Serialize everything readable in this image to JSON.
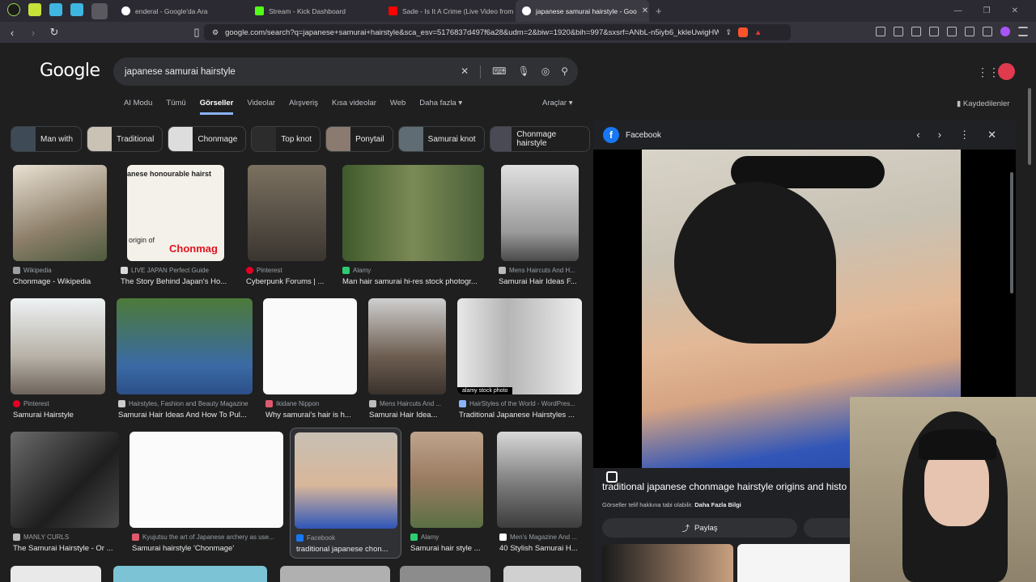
{
  "tabs": [
    {
      "title": "enderal - Google'da Ara",
      "color": "#4285f4",
      "active": false
    },
    {
      "title": "Stream - Kick Dashboard",
      "color": "#53fc18",
      "active": false
    },
    {
      "title": "Sade - Is It A Crime (Live Video from",
      "color": "#ff0000",
      "active": false
    },
    {
      "title": "japanese samurai hairstyle - Goo",
      "color": "#4285f4",
      "active": true
    }
  ],
  "browser": {
    "url": "google.com/search?q=japanese+samurai+hairstyle&sca_esv=5176837d497f6a28&udm=2&biw=1920&bih=997&sxsrf=ANbL-n5iyb6_kkleUwigHWH...",
    "new_tab": "+"
  },
  "google": {
    "logo": "Google",
    "query": "japanese samurai hairstyle",
    "filters": [
      "AI Modu",
      "Tümü",
      "Görseller",
      "Videolar",
      "Alışveriş",
      "Kısa videolar",
      "Web",
      "Daha fazla ▾"
    ],
    "tools": "Araçlar ▾",
    "saved": "Kaydedilenler"
  },
  "chips": [
    "Man with",
    "Traditional",
    "Chonmage",
    "Top knot",
    "Ponytail",
    "Samurai knot",
    "Chonmage hairstyle"
  ],
  "results": [
    {
      "source": "Wikipedia",
      "title": "Chonmage - Wikipedia",
      "color": "#9aa0a6"
    },
    {
      "source": "LIVE JAPAN Perfect Guide",
      "title": "The Story Behind Japan's Ho...",
      "color": "#d9d9d9"
    },
    {
      "source": "Pinterest",
      "title": "Cyberpunk Forums | ...",
      "color": "#e60023"
    },
    {
      "source": "Alamy",
      "title": "Man hair samurai hi-res stock photogr...",
      "color": "#2ecc71"
    },
    {
      "source": "Mens Haircuts And H...",
      "title": "Samurai Hair Ideas F...",
      "color": "#bbbbbb"
    },
    {
      "source": "Pinterest",
      "title": "Samurai Hairstyle",
      "color": "#e60023"
    },
    {
      "source": "Hairstyles, Fashion and Beauty Magazine",
      "title": "Samurai Hair Ideas And How To Pul...",
      "color": "#cccccc"
    },
    {
      "source": "Ikidane Nippon",
      "title": "Why samurai's hair is h...",
      "color": "#e05a6d"
    },
    {
      "source": "Mens Haircuts And ...",
      "title": "Samurai Hair Idea...",
      "color": "#bbbbbb"
    },
    {
      "source": "HairStyles of the World - WordPres...",
      "title": "Traditional Japanese Hairstyles ...",
      "color": "#8ab4f8"
    },
    {
      "source": "MANLY CURLS",
      "title": "The Samurai Hairstyle - Or ...",
      "color": "#bbbbbb"
    },
    {
      "source": "Kyujutsu the art of Japanese archery as use...",
      "title": "Samurai hairstyle 'Chonmage'",
      "color": "#e05a6d"
    },
    {
      "source": "Facebook",
      "title": "traditional japanese chon...",
      "color": "#1877f2"
    },
    {
      "source": "Alamy",
      "title": "Samurai hair style ...",
      "color": "#2ecc71"
    },
    {
      "source": "Men's Magazine And ...",
      "title": "40 Stylish Samurai H...",
      "color": "#ffffff"
    }
  ],
  "overlays": {
    "top_text": "anese honourable hairst",
    "bottom_text": "origin of",
    "red_text": "Chonmag",
    "alamy": "alamy stock photo"
  },
  "panel": {
    "source": "Facebook",
    "fb_letter": "f",
    "title": "traditional japanese chonmage hairstyle origins and histo",
    "note": "Görseller telif hakkına tabi olabilir.",
    "note_link": "Daha Fazla Bilgi",
    "share": "Paylaş"
  }
}
